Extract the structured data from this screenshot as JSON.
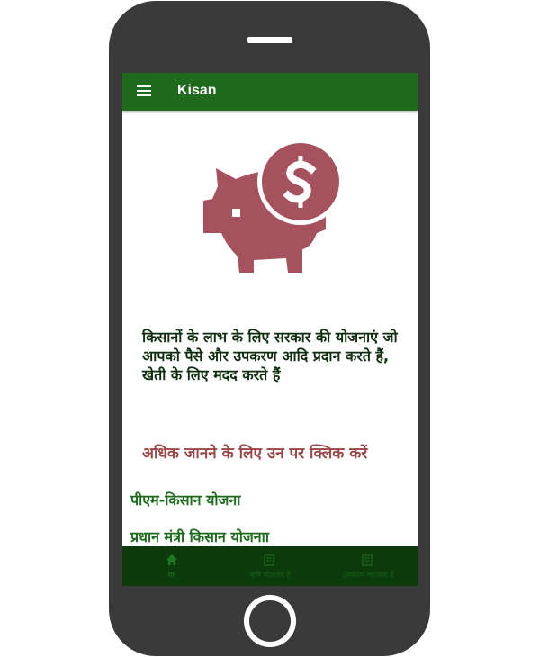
{
  "app": {
    "title": "Kisan"
  },
  "main": {
    "description": "किसानों के लाभ के लिए सरकार की योजनाएं जो आपको पैसे और उपकरण आदि प्रदान करते हैं, खेती के लिए मदद करते हैं",
    "learn_more": "अधिक जानने के लिए उन पर क्लिक करें",
    "schemes": [
      "पीएम-किसान योजना",
      "प्रधान मंत्री किसान योजनाा"
    ]
  },
  "bottom_nav": [
    {
      "label": "घर",
      "icon": "home-icon",
      "active": true
    },
    {
      "label": "कृषि योजनाएं हैं",
      "icon": "document-edit-icon",
      "active": false
    },
    {
      "label": "उपकरण सहायता हैं",
      "icon": "document-edit-icon",
      "active": false
    }
  ],
  "colors": {
    "appbar": "#1e6b1e",
    "bottom_nav": "#0b3a0b",
    "accent_maroon": "#9a4646",
    "piggy": "#a6525e"
  }
}
